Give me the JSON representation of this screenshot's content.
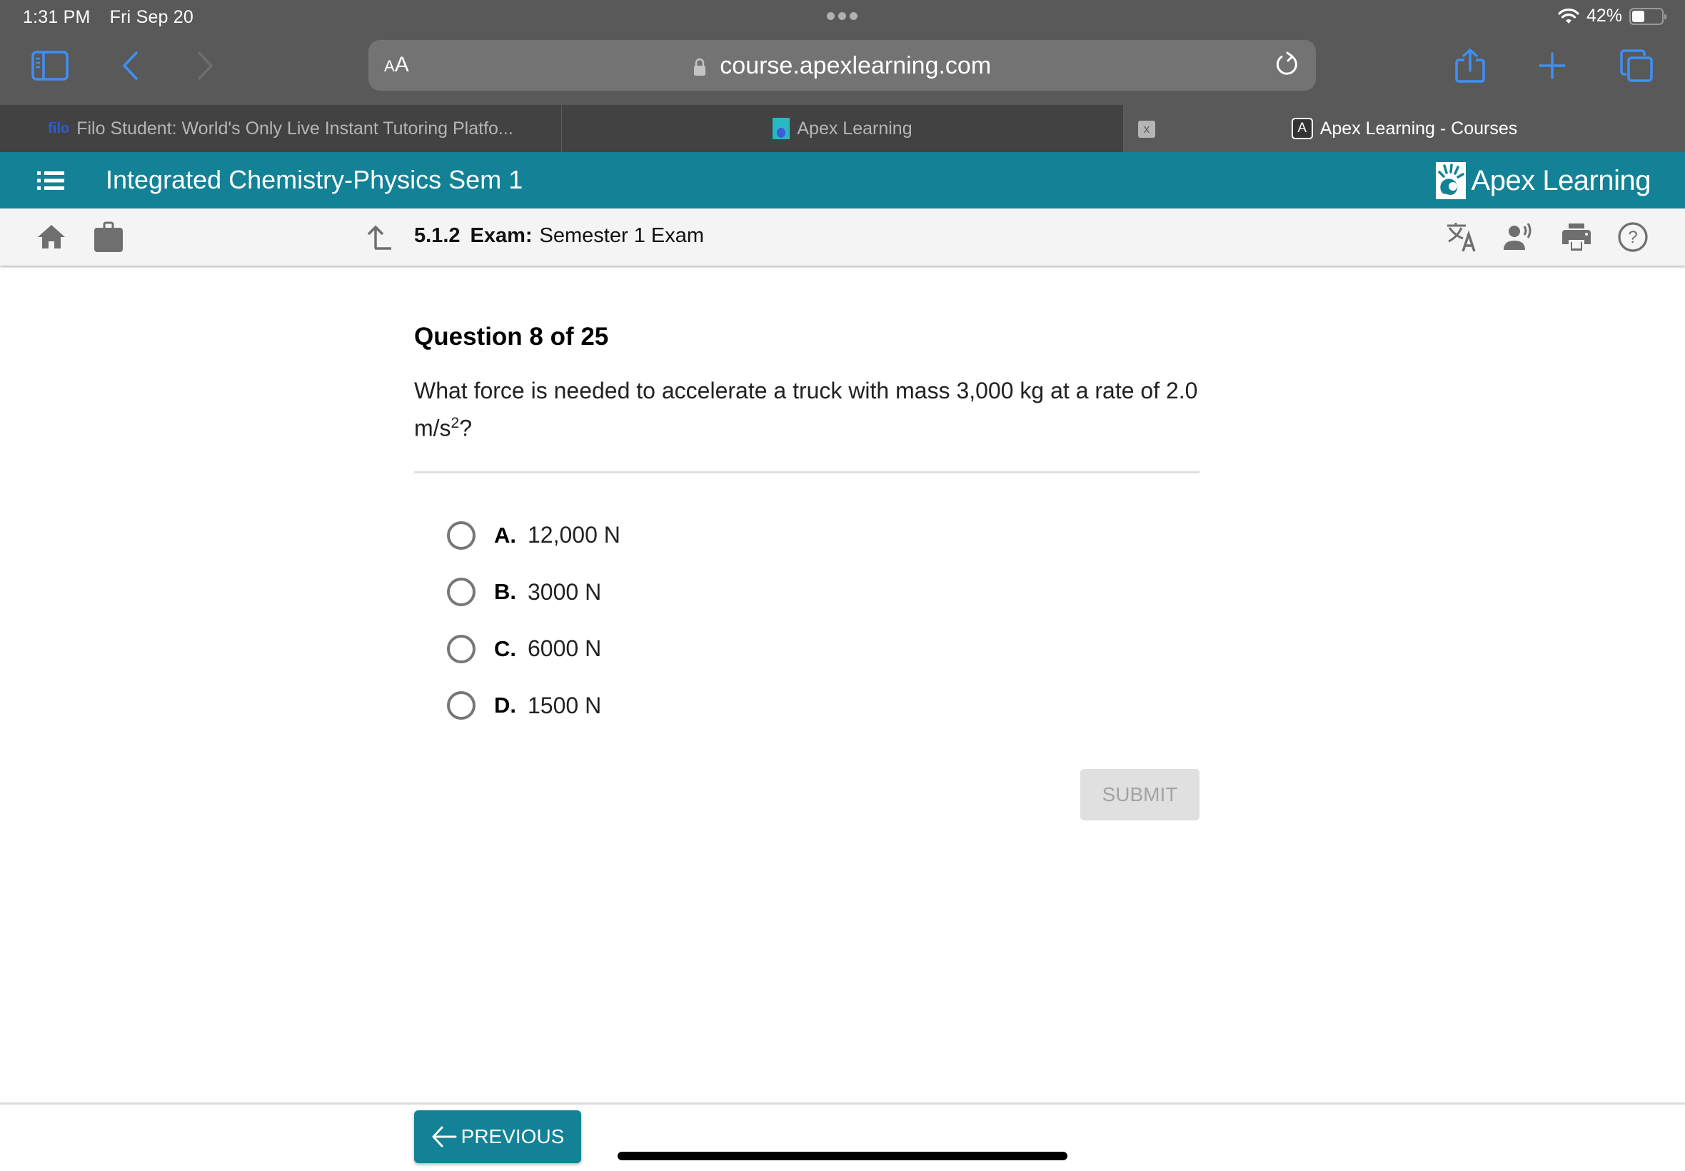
{
  "status_bar": {
    "time": "1:31 PM",
    "date": "Fri Sep 20",
    "battery_percent": "42%",
    "battery_level": 0.42
  },
  "browser": {
    "text_size_label": "AA",
    "url": "course.apexlearning.com",
    "tabs": [
      {
        "title": "Filo Student: World's Only Live Instant Tutoring Platfo...",
        "favicon": "filo",
        "active": false
      },
      {
        "title": "Apex Learning",
        "favicon": "apex-logo",
        "active": false
      },
      {
        "title": "Apex Learning - Courses",
        "favicon": "A",
        "active": true
      }
    ],
    "close_tab_label": "x"
  },
  "app": {
    "course_title": "Integrated Chemistry-Physics Sem 1",
    "brand": "Apex Learning",
    "brand_color": "#138296"
  },
  "breadcrumb": {
    "number": "5.1.2",
    "type": "Exam:",
    "title": "Semester 1 Exam"
  },
  "question": {
    "header": "Question 8 of 25",
    "current": 8,
    "total": 25,
    "text_main": "What force is needed to accelerate a truck with mass 3,000 kg at a rate of 2.0 m/s",
    "text_superscript": "2",
    "text_end": "?",
    "options": [
      {
        "letter": "A.",
        "text": "12,000 N",
        "selected": false
      },
      {
        "letter": "B.",
        "text": "3000 N",
        "selected": false
      },
      {
        "letter": "C.",
        "text": "6000 N",
        "selected": false
      },
      {
        "letter": "D.",
        "text": "1500 N",
        "selected": false
      }
    ]
  },
  "buttons": {
    "submit": "SUBMIT",
    "previous": "PREVIOUS"
  }
}
